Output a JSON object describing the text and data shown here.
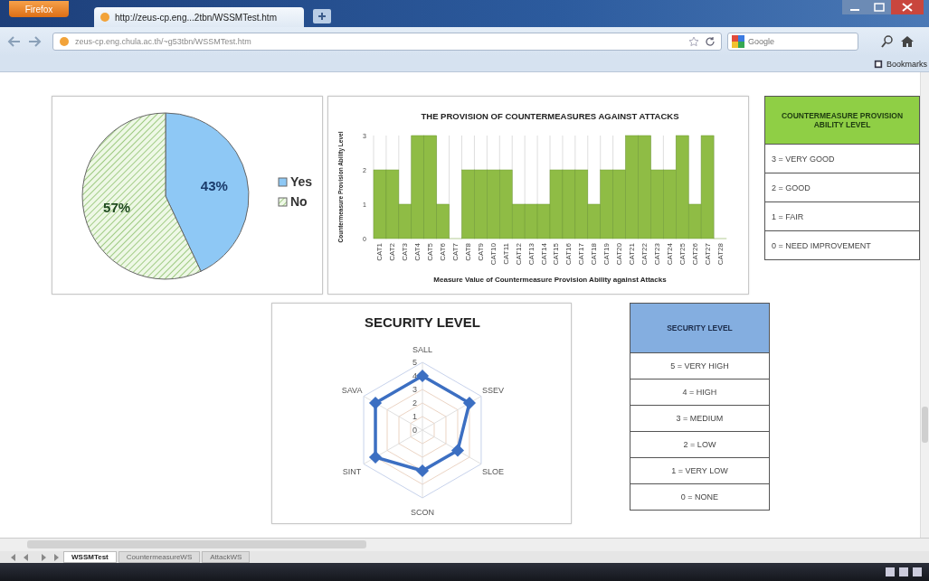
{
  "browser": {
    "menu_button": "Firefox",
    "tab_title": "http://zeus-cp.eng...2tbn/WSSMTest.htm",
    "url": "zeus-cp.eng.chula.ac.th/~g53tbn/WSSMTest.htm",
    "search_placeholder": "Google",
    "bookmarks": "Bookmarks"
  },
  "pie": {
    "chart_data": {
      "type": "pie",
      "categories": [
        "Yes",
        "No"
      ],
      "series": [
        {
          "values": [
            43,
            57
          ]
        }
      ],
      "value_labels": [
        "43%",
        "57%"
      ],
      "legend": "right"
    }
  },
  "bar": {
    "chart_data": {
      "type": "bar",
      "title": "THE  PROVISION OF COUNTERMEASURES  AGAINST ATTACKS",
      "xlabel": "Measure Value of Countermeasure Provision Ability against Attacks",
      "ylabel": "Countermeasure Provision Ability Level",
      "categories": [
        "CAT1",
        "CAT2",
        "CAT3",
        "CAT4",
        "CAT5",
        "CAT6",
        "CAT7",
        "CAT8",
        "CAT9",
        "CAT10",
        "CAT11",
        "CAT12",
        "CAT13",
        "CAT14",
        "CAT15",
        "CAT16",
        "CAT17",
        "CAT18",
        "CAT19",
        "CAT20",
        "CAT21",
        "CAT22",
        "CAT23",
        "CAT24",
        "CAT25",
        "CAT26",
        "CAT27",
        "CAT28"
      ],
      "series": [
        {
          "color": "#8fbc45",
          "values": [
            2,
            2,
            1,
            3,
            3,
            1,
            0,
            2,
            2,
            2,
            2,
            1,
            1,
            1,
            2,
            2,
            2,
            1,
            2,
            2,
            3,
            3,
            2,
            2,
            3,
            1,
            3,
            0
          ]
        }
      ],
      "ylim": [
        0,
        3
      ],
      "yticks": [
        0,
        1,
        2,
        3
      ]
    }
  },
  "provision_table": {
    "header": "COUNTERMEASURE PROVISION ABILITY LEVEL",
    "rows": [
      "3 = VERY GOOD",
      "2 = GOOD",
      "1 = FAIR",
      "0 = NEED IMPROVEMENT"
    ]
  },
  "radar": {
    "chart_data": {
      "type": "radar",
      "title": "SECURITY LEVEL",
      "categories": [
        "SALL",
        "SSEV",
        "SLOE",
        "SCON",
        "SINT",
        "SAVA"
      ],
      "series": [
        {
          "color": "#3c6fc2",
          "values": [
            4,
            4,
            3,
            3,
            4,
            4
          ]
        }
      ],
      "ylim": [
        0,
        5
      ],
      "yticks": [
        0,
        1,
        2,
        3,
        4,
        5
      ]
    }
  },
  "security_table": {
    "header": "SECURITY LEVEL",
    "rows": [
      "5 = VERY HIGH",
      "4 = HIGH",
      "3 = MEDIUM",
      "2 = LOW",
      "1 = VERY LOW",
      "0 = NONE"
    ]
  },
  "sheet_tabs": [
    {
      "label": "WSSMTest",
      "selected": true
    },
    {
      "label": "CountermeasureWS",
      "selected": false
    },
    {
      "label": "AttackWS",
      "selected": false
    }
  ]
}
